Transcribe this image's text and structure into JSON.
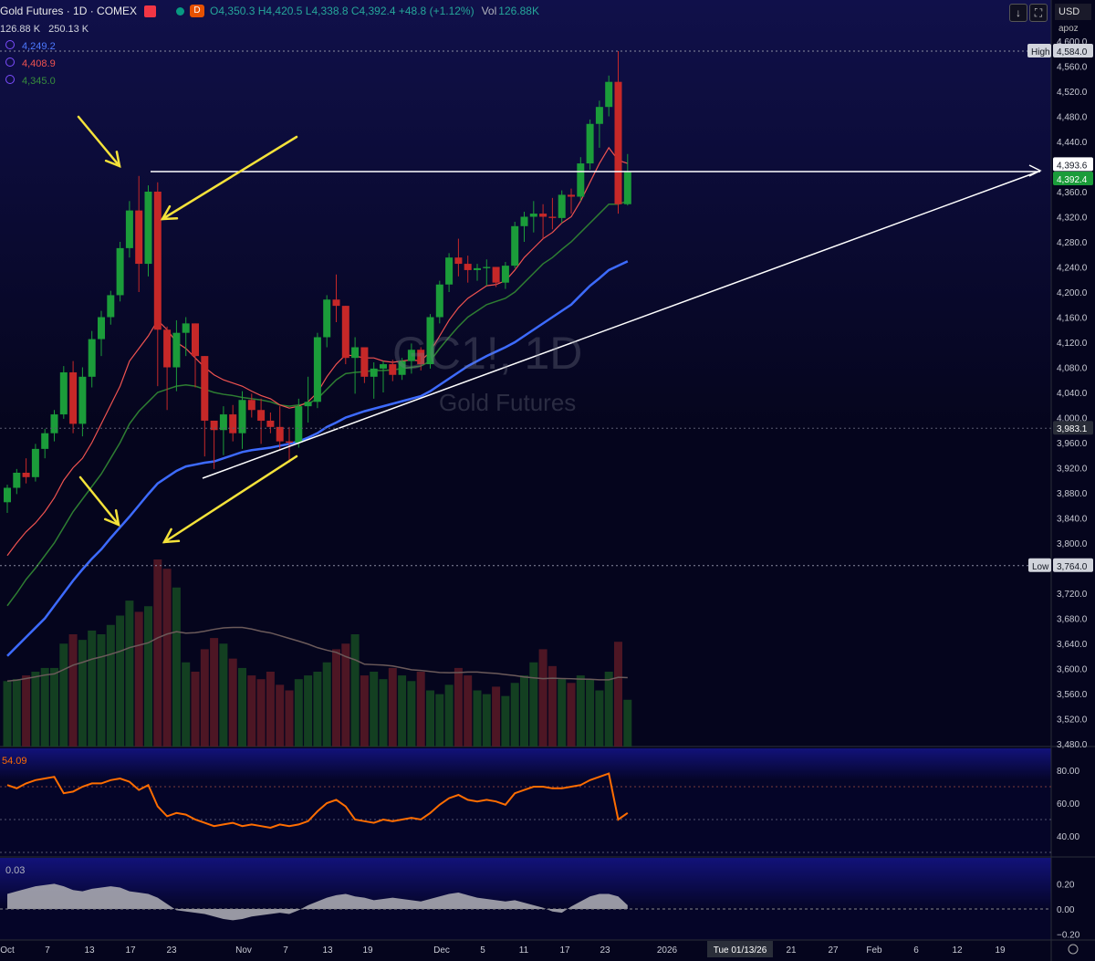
{
  "header": {
    "symbol": "Gold Futures · 1D · COMEX",
    "badge": "D",
    "ohlc": "O4,350.3 H4,420.5 L4,338.8 C4,392.4 +48.8 (+1.12%)",
    "vol_label": "Vol",
    "vol_value": "126.88K",
    "vol_line2a": "126.88 K",
    "vol_line2b": "250.13 K"
  },
  "indicators": [
    {
      "value": "4,249.2",
      "color": "#4d79ff"
    },
    {
      "value": "4,408.9",
      "color": "#ef5350"
    },
    {
      "value": "4,345.0",
      "color": "#388e3c"
    }
  ],
  "toolbar": {
    "currency": "USD",
    "sub": "apoz"
  },
  "watermark": {
    "symbol": "GC1!, 1D",
    "name": "Gold Futures"
  },
  "colors": {
    "up": "#1b9c3a",
    "down": "#c62828",
    "ema_fast": "#ef5350",
    "ema_mid": "#2e7d32",
    "ema_slow": "#3d6bff",
    "rsi": "#ff6d00",
    "yellow": "#f4e23a"
  },
  "price_axis": {
    "labels": [
      "4,600.0",
      "4,560.0",
      "4,520.0",
      "4,480.0",
      "4,440.0",
      "4,400.0",
      "4,360.0",
      "4,320.0",
      "4,280.0",
      "4,240.0",
      "4,200.0",
      "4,160.0",
      "4,120.0",
      "4,080.0",
      "4,040.0",
      "4,000.0",
      "3,960.0",
      "3,920.0",
      "3,880.0",
      "3,840.0",
      "3,800.0",
      "3,760.0",
      "3,720.0",
      "3,680.0",
      "3,640.0",
      "3,600.0",
      "3,560.0",
      "3,520.0",
      "3,480.0"
    ],
    "high_tag": "High",
    "high_value": "4,584.0",
    "low_tag": "Low",
    "low_value": "3,764.0",
    "price_a": "4,393.6",
    "price_b": "4,392.4",
    "price_c": "3,983.1"
  },
  "rsi": {
    "value": "54.09",
    "labels": [
      "80.00",
      "60.00",
      "40.00"
    ]
  },
  "osc": {
    "value": "0.03",
    "labels": [
      "0.20",
      "0.00",
      "−0.20"
    ]
  },
  "time_axis": [
    "Oct",
    "7",
    "13",
    "17",
    "23",
    "Nov",
    "7",
    "13",
    "19",
    "Dec",
    "5",
    "11",
    "17",
    "23",
    "2026",
    "Tue 01/13/26",
    "21",
    "27",
    "Feb",
    "6",
    "12",
    "19"
  ],
  "chart_data": {
    "type": "candlestick",
    "title": "Gold Futures · 1D · COMEX",
    "ylim": [
      3480,
      4600
    ],
    "candles": [
      [
        3865,
        3893,
        3848,
        3888
      ],
      [
        3888,
        3918,
        3878,
        3912
      ],
      [
        3912,
        3935,
        3895,
        3905
      ],
      [
        3905,
        3958,
        3898,
        3950
      ],
      [
        3950,
        3982,
        3935,
        3975
      ],
      [
        3975,
        4012,
        3962,
        4005
      ],
      [
        4005,
        4082,
        3998,
        4072
      ],
      [
        4072,
        4090,
        3975,
        3990
      ],
      [
        3990,
        4080,
        3970,
        4065
      ],
      [
        4065,
        4138,
        4048,
        4125
      ],
      [
        4125,
        4170,
        4098,
        4160
      ],
      [
        4160,
        4202,
        4148,
        4195
      ],
      [
        4195,
        4280,
        4185,
        4270
      ],
      [
        4270,
        4345,
        4255,
        4330
      ],
      [
        4330,
        4385,
        4200,
        4245
      ],
      [
        4245,
        4370,
        4225,
        4360
      ],
      [
        4360,
        4375,
        4050,
        4140
      ],
      [
        4140,
        4145,
        4012,
        4080
      ],
      [
        4080,
        4155,
        4042,
        4135
      ],
      [
        4135,
        4160,
        4098,
        4150
      ],
      [
        4150,
        4135,
        4048,
        4098
      ],
      [
        4098,
        4065,
        3938,
        3995
      ],
      [
        3995,
        3995,
        3918,
        3980
      ],
      [
        3980,
        4018,
        3940,
        4005
      ],
      [
        4005,
        4020,
        3962,
        3975
      ],
      [
        3975,
        4042,
        3950,
        4028
      ],
      [
        4028,
        4038,
        4000,
        4012
      ],
      [
        4012,
        4030,
        3958,
        3995
      ],
      [
        3995,
        4008,
        3975,
        3985
      ],
      [
        3985,
        4018,
        3950,
        3962
      ],
      [
        3962,
        3985,
        3928,
        3960
      ],
      [
        3960,
        4030,
        3952,
        4018
      ],
      [
        4018,
        4065,
        3992,
        4025
      ],
      [
        4025,
        4135,
        4015,
        4128
      ],
      [
        4128,
        4195,
        4112,
        4188
      ],
      [
        4188,
        4228,
        4152,
        4178
      ],
      [
        4178,
        4150,
        4085,
        4095
      ],
      [
        4095,
        4128,
        4038,
        4112
      ],
      [
        4112,
        4085,
        4055,
        4065
      ],
      [
        4065,
        4088,
        4030,
        4078
      ],
      [
        4078,
        4090,
        4040,
        4085
      ],
      [
        4085,
        4092,
        4058,
        4068
      ],
      [
        4068,
        4095,
        4060,
        4090
      ],
      [
        4090,
        4118,
        4070,
        4108
      ],
      [
        4108,
        4112,
        4075,
        4085
      ],
      [
        4085,
        4165,
        4078,
        4160
      ],
      [
        4160,
        4218,
        4150,
        4212
      ],
      [
        4212,
        4262,
        4200,
        4255
      ],
      [
        4255,
        4285,
        4225,
        4245
      ],
      [
        4245,
        4258,
        4215,
        4235
      ],
      [
        4235,
        4245,
        4218,
        4238
      ],
      [
        4238,
        4252,
        4210,
        4240
      ],
      [
        4240,
        4232,
        4208,
        4215
      ],
      [
        4215,
        4248,
        4205,
        4242
      ],
      [
        4242,
        4312,
        4238,
        4305
      ],
      [
        4305,
        4328,
        4280,
        4320
      ],
      [
        4320,
        4345,
        4295,
        4325
      ],
      [
        4325,
        4340,
        4285,
        4320
      ],
      [
        4320,
        4350,
        4300,
        4318
      ],
      [
        4318,
        4362,
        4310,
        4355
      ],
      [
        4355,
        4365,
        4325,
        4352
      ],
      [
        4352,
        4415,
        4345,
        4405
      ],
      [
        4405,
        4475,
        4395,
        4468
      ],
      [
        4468,
        4505,
        4430,
        4495
      ],
      [
        4495,
        4545,
        4480,
        4535
      ],
      [
        4535,
        4584,
        4325,
        4340
      ],
      [
        4340,
        4420,
        4338,
        4392
      ]
    ],
    "ema_fast": [
      3780,
      3800,
      3818,
      3832,
      3850,
      3872,
      3900,
      3920,
      3935,
      3960,
      3990,
      4020,
      4050,
      4090,
      4110,
      4130,
      4155,
      4140,
      4120,
      4110,
      4095,
      4080,
      4068,
      4060,
      4055,
      4050,
      4042,
      4035,
      4030,
      4020,
      4015,
      4018,
      4025,
      4040,
      4065,
      4085,
      4100,
      4098,
      4095,
      4095,
      4090,
      4088,
      4090,
      4092,
      4090,
      4105,
      4130,
      4155,
      4175,
      4190,
      4200,
      4210,
      4212,
      4218,
      4235,
      4255,
      4270,
      4285,
      4295,
      4310,
      4320,
      4345,
      4375,
      4405,
      4430,
      4410,
      4405
    ],
    "ema_mid": [
      3700,
      3720,
      3742,
      3760,
      3780,
      3800,
      3825,
      3850,
      3870,
      3890,
      3910,
      3935,
      3960,
      3990,
      4010,
      4025,
      4040,
      4045,
      4050,
      4052,
      4050,
      4045,
      4040,
      4037,
      4035,
      4032,
      4030,
      4028,
      4025,
      4020,
      4018,
      4020,
      4022,
      4030,
      4045,
      4060,
      4070,
      4072,
      4073,
      4075,
      4075,
      4076,
      4078,
      4080,
      4082,
      4090,
      4110,
      4128,
      4145,
      4160,
      4170,
      4180,
      4185,
      4190,
      4200,
      4215,
      4230,
      4245,
      4255,
      4268,
      4280,
      4295,
      4310,
      4325,
      4340,
      4340,
      4345
    ],
    "ema_slow": [
      3620,
      3635,
      3650,
      3665,
      3680,
      3700,
      3720,
      3740,
      3758,
      3775,
      3790,
      3808,
      3825,
      3842,
      3860,
      3878,
      3895,
      3905,
      3915,
      3922,
      3925,
      3928,
      3930,
      3935,
      3940,
      3945,
      3948,
      3950,
      3952,
      3955,
      3958,
      3962,
      3968,
      3975,
      3985,
      3992,
      4000,
      4005,
      4010,
      4014,
      4018,
      4022,
      4026,
      4030,
      4034,
      4042,
      4052,
      4062,
      4072,
      4082,
      4090,
      4098,
      4105,
      4112,
      4120,
      4130,
      4140,
      4150,
      4160,
      4170,
      4180,
      4195,
      4210,
      4222,
      4235,
      4242,
      4249
    ],
    "volume": [
      0.35,
      0.36,
      0.38,
      0.4,
      0.42,
      0.42,
      0.55,
      0.6,
      0.57,
      0.62,
      0.6,
      0.65,
      0.7,
      0.78,
      0.72,
      0.75,
      1.0,
      0.95,
      0.85,
      0.45,
      0.4,
      0.52,
      0.58,
      0.55,
      0.47,
      0.42,
      0.38,
      0.36,
      0.4,
      0.33,
      0.3,
      0.36,
      0.38,
      0.4,
      0.45,
      0.52,
      0.55,
      0.6,
      0.38,
      0.4,
      0.36,
      0.42,
      0.38,
      0.35,
      0.4,
      0.3,
      0.28,
      0.33,
      0.42,
      0.38,
      0.3,
      0.28,
      0.32,
      0.27,
      0.34,
      0.38,
      0.45,
      0.52,
      0.43,
      0.36,
      0.34,
      0.38,
      0.36,
      0.3,
      0.4,
      0.56,
      0.25
    ],
    "rsi": [
      71,
      69,
      72,
      74,
      75,
      76,
      66,
      67,
      70,
      72,
      72,
      74,
      75,
      73,
      68,
      71,
      58,
      52,
      54,
      53,
      50,
      48,
      46,
      47,
      48,
      46,
      47,
      46,
      45,
      47,
      46,
      47,
      49,
      55,
      60,
      62,
      58,
      50,
      49,
      48,
      50,
      49,
      50,
      51,
      50,
      54,
      59,
      63,
      65,
      62,
      61,
      62,
      61,
      59,
      66,
      68,
      70,
      70,
      69,
      69,
      70,
      71,
      74,
      76,
      78,
      50,
      54
    ],
    "osc": [
      0.12,
      0.14,
      0.16,
      0.18,
      0.19,
      0.2,
      0.18,
      0.15,
      0.14,
      0.16,
      0.17,
      0.18,
      0.17,
      0.14,
      0.13,
      0.12,
      0.09,
      0.04,
      -0.01,
      -0.02,
      -0.03,
      -0.04,
      -0.06,
      -0.08,
      -0.09,
      -0.08,
      -0.06,
      -0.05,
      -0.04,
      -0.03,
      -0.04,
      -0.01,
      0.03,
      0.06,
      0.09,
      0.11,
      0.12,
      0.1,
      0.09,
      0.07,
      0.08,
      0.09,
      0.08,
      0.07,
      0.06,
      0.08,
      0.1,
      0.12,
      0.13,
      0.11,
      0.09,
      0.08,
      0.07,
      0.06,
      0.07,
      0.05,
      0.03,
      0.01,
      -0.02,
      -0.03,
      0.02,
      0.06,
      0.1,
      0.12,
      0.12,
      0.1,
      0.03
    ]
  }
}
